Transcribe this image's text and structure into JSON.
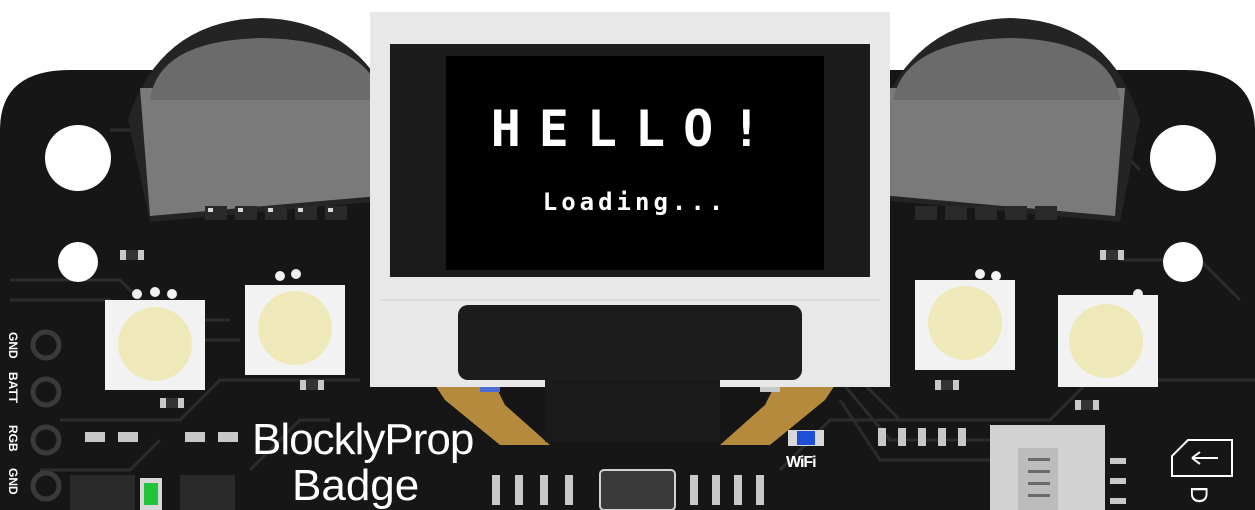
{
  "board": {
    "name": "BlocklyProp",
    "subtitle": "Badge",
    "colors": {
      "pcb": "#161616",
      "trace": "#2b2b2b",
      "oled_frame": "#e8e8e8",
      "oled_screen": "#000000",
      "flex_cable": "#b68a3c",
      "led_lens": "#efe9b9",
      "accent_blue": "#1e4fd6",
      "accent_green": "#22c43a"
    }
  },
  "oled": {
    "line1": "HELLO!",
    "line2": "Loading..."
  },
  "labels": {
    "wifi": "WiFi",
    "sd": "D"
  },
  "header_pins": [
    "GND",
    "BATT",
    "RGB",
    "GND"
  ]
}
